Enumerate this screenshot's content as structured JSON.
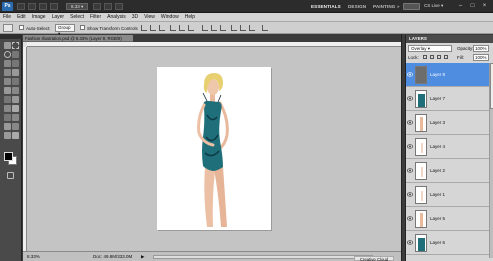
{
  "app": {
    "logo": "Ps",
    "zoom": "8.33",
    "workspaces": [
      "ESSENTIALS",
      "DESIGN",
      "PAINTING"
    ],
    "workspace_more": "»",
    "cs_live": "CS Live ▾",
    "window_controls": [
      "–",
      "□",
      "×"
    ]
  },
  "menu": [
    "File",
    "Edit",
    "Image",
    "Layer",
    "Select",
    "Filter",
    "Analysis",
    "3D",
    "View",
    "Window",
    "Help"
  ],
  "options": {
    "auto_select_label": "Auto-Select:",
    "auto_select_value": "Group",
    "show_transform_label": "Show Transform Controls"
  },
  "document": {
    "tab_title": "Fashion Illustration.psd @ 8.33% (Layer 8, RGB/8)",
    "zoom_level": "8.33%",
    "doc_size": "Doc: 49.8M/333.0M",
    "status_arrow": "▶",
    "tooltip": "Creative Cloud"
  },
  "layers_panel": {
    "title": "LAYERS",
    "blend_mode": "Overlay",
    "opacity_label": "Opacity:",
    "opacity_value": "100%",
    "lock_label": "Lock:",
    "fill_label": "Fill:",
    "fill_value": "100%",
    "layers": [
      {
        "name": "Layer 8",
        "selected": true,
        "thumb": "dark"
      },
      {
        "name": "Layer 7",
        "selected": false,
        "thumb": "teal"
      },
      {
        "name": "Layer 3",
        "selected": false,
        "thumb": "skin"
      },
      {
        "name": "Layer 4",
        "selected": false,
        "thumb": "light"
      },
      {
        "name": "Layer 2",
        "selected": false,
        "thumb": "light"
      },
      {
        "name": "Layer 1",
        "selected": false,
        "thumb": "light"
      },
      {
        "name": "Layer 5",
        "selected": false,
        "thumb": "skin"
      },
      {
        "name": "Layer 6",
        "selected": false,
        "thumb": "teal"
      }
    ]
  },
  "colors": {
    "selection": "#4f8de0",
    "swimsuit": "#1f6f7a",
    "hair": "#e8d070",
    "skin": "#e9b99c"
  }
}
